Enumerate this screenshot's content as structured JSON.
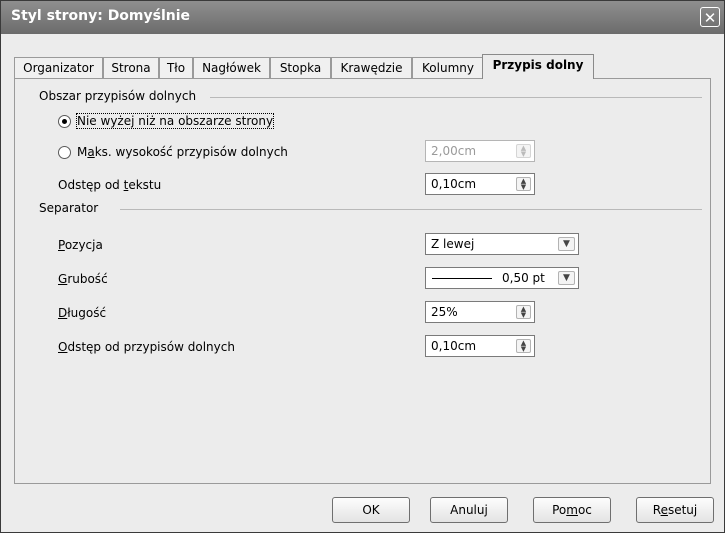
{
  "window": {
    "title": "Styl strony: Domyślnie",
    "close_glyph": "✕"
  },
  "tabs": [
    {
      "label": "Organizator"
    },
    {
      "label": "Strona"
    },
    {
      "label": "Tło"
    },
    {
      "label": "Nagłówek"
    },
    {
      "label": "Stopka"
    },
    {
      "label": "Krawędzie"
    },
    {
      "label": "Kolumny"
    },
    {
      "label": "Przypis dolny",
      "active": true
    }
  ],
  "footnote_area": {
    "section_label": "Obszar przypisów dolnych",
    "radio_not_larger": {
      "label": "Nie wyżej niż na obszarze strony",
      "checked": true
    },
    "radio_max_height": {
      "label_pre": "M",
      "label_acc": "a",
      "label_post": "ks. wysokość przypisów dolnych",
      "checked": false,
      "value": "2,00cm"
    },
    "spacing_to_text": {
      "label_pre": "Odstęp od ",
      "label_acc": "t",
      "label_post": "ekstu",
      "value": "0,10cm"
    }
  },
  "separator": {
    "section_label": "Separator",
    "position": {
      "label_acc": "P",
      "label_post": "ozycja",
      "value": "Z lewej"
    },
    "weight": {
      "label_acc": "G",
      "label_post": "rubość",
      "value": "0,50 pt"
    },
    "length": {
      "label_pre": "",
      "label_acc": "D",
      "label_post": "ługość",
      "value": "25%"
    },
    "spacing_to_contents": {
      "label_acc": "O",
      "label_post": "dstęp od przypisów dolnych",
      "value": "0,10cm"
    }
  },
  "buttons": {
    "ok": "OK",
    "cancel": "Anuluj",
    "help_pre": "Po",
    "help_acc": "m",
    "help_post": "oc",
    "reset_pre": "R",
    "reset_acc": "e",
    "reset_post": "setuj"
  },
  "icons": {
    "spin": "spin-arrows-icon",
    "dropdown": "chevron-down-icon",
    "close": "close-icon"
  }
}
